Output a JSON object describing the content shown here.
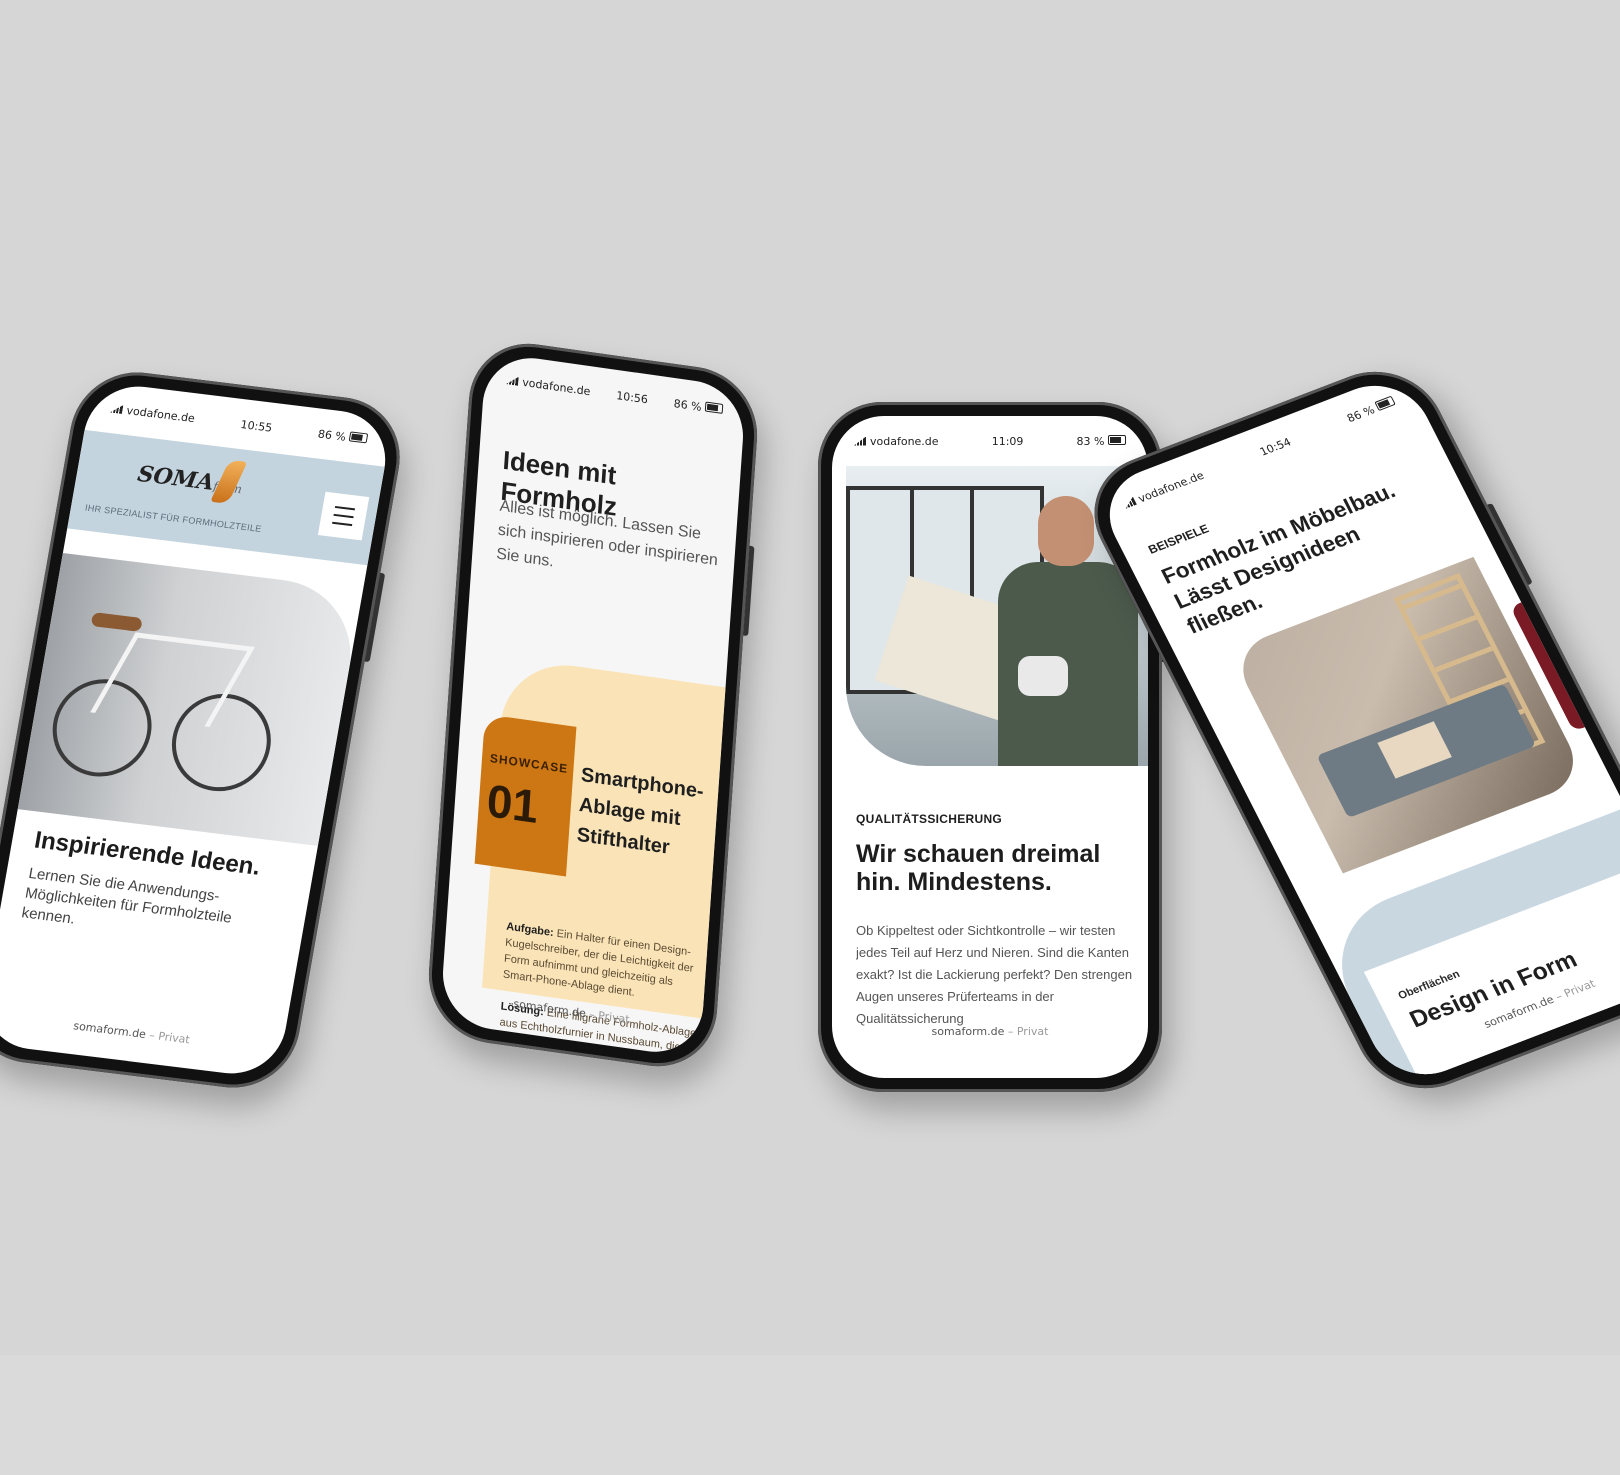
{
  "phone1": {
    "status": {
      "carrier": "vodafone.de",
      "time": "10:55",
      "battery": "86 %"
    },
    "logo_main": "SOMA",
    "logo_sub": "form",
    "tagline": "IHR SPEZIALIST FÜR FORMHOLZTEILE",
    "title": "Inspirierende Ideen.",
    "text": "Lernen Sie die Anwendungs-Möglichkeiten für Formholzteile kennen.",
    "url": "somaform.de",
    "url_suffix": "– Privat"
  },
  "phone2": {
    "status": {
      "carrier": "vodafone.de",
      "time": "10:56",
      "battery": "86 %"
    },
    "heading": "Ideen mit Formholz",
    "subtext": "Alles ist möglich. Lassen Sie sich inspirieren oder inspirieren Sie uns.",
    "showcase_label": "SHOWCASE",
    "showcase_num": "01",
    "case_title": "Smartphone-Ablage mit Stifthalter",
    "task_label": "Aufgabe:",
    "task_text": "Ein Halter für einen Design-Kugelschreiber, der die Leichtigkeit der Form aufnimmt und gleichzeitig als Smart-Phone-Ablage dient.",
    "solution_label": "Lösung:",
    "solution_text": "Eine filigrane Formholz-Ablage aus Echtholzfurnier in Nussbaum, die",
    "url": "somaform.de",
    "url_suffix": "– Privat"
  },
  "phone3": {
    "status": {
      "carrier": "vodafone.de",
      "time": "11:09",
      "battery": "83 %"
    },
    "kicker": "QUALITÄTSSICHERUNG",
    "title": "Wir schauen dreimal hin. Mindestens.",
    "text": "Ob Kippeltest oder Sichtkontrolle – wir testen jedes Teil auf Herz und Nieren. Sind die Kanten exakt? Ist die Lackierung perfekt? Den strengen Augen unseres Prüferteams in der Qualitätssicherung",
    "url": "somaform.de",
    "url_suffix": "– Privat"
  },
  "phone4": {
    "status": {
      "carrier": "vodafone.de",
      "time": "10:54",
      "battery": "86 %"
    },
    "kicker": "BEISPIELE",
    "title": "Formholz im Möbelbau. Lässt Designideen fließen.",
    "card_kicker": "Oberflächen",
    "card_title": "Design in Form",
    "url": "somaform.de",
    "url_suffix": "– Privat"
  }
}
